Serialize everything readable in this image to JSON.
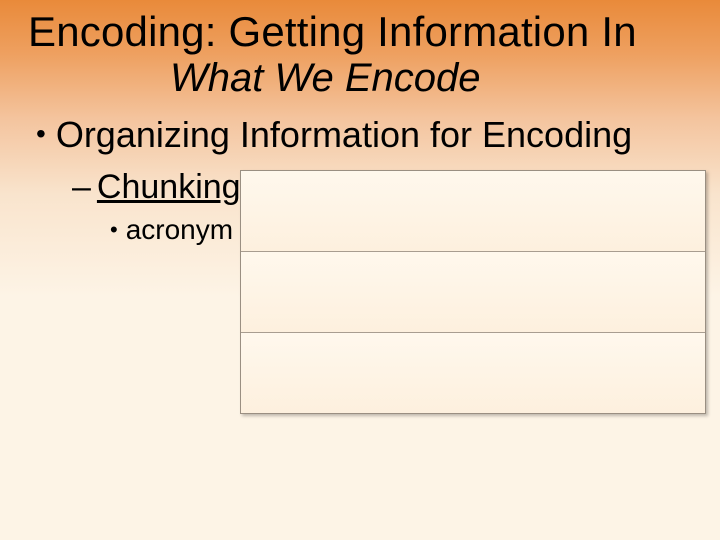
{
  "title": "Encoding: Getting Information In",
  "subtitle": "What We Encode",
  "outline": {
    "level1": "Organizing Information for Encoding",
    "level2": "Chunking",
    "level3": "acronym"
  },
  "panel": {
    "rows": [
      "",
      "",
      ""
    ]
  }
}
